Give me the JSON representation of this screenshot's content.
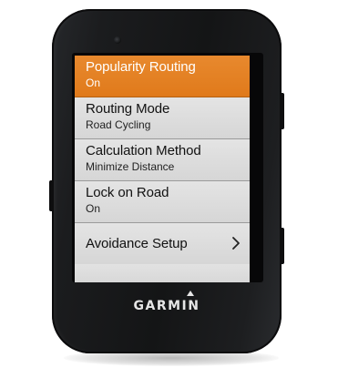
{
  "device": {
    "brand": "GARMIN"
  },
  "menu": {
    "items": [
      {
        "title": "Popularity Routing",
        "value": "On",
        "selected": true
      },
      {
        "title": "Routing Mode",
        "value": "Road Cycling",
        "selected": false
      },
      {
        "title": "Calculation Method",
        "value": "Minimize Distance",
        "selected": false
      },
      {
        "title": "Lock on Road",
        "value": "On",
        "selected": false
      },
      {
        "title": "Avoidance Setup",
        "value": "",
        "selected": false,
        "has_submenu": true,
        "icon": "chevron-right-icon"
      }
    ]
  },
  "colors": {
    "accent": "#e07a1b",
    "list_background": "#d9d9d9",
    "device_body": "#161718"
  }
}
